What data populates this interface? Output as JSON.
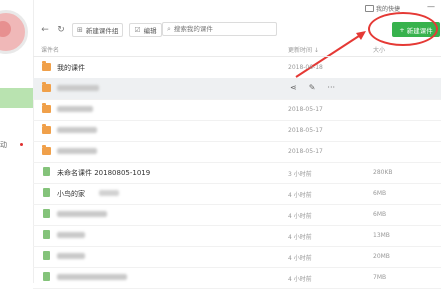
{
  "topbar": {
    "feedback_label": "我的快捷",
    "minimize_glyph": "—",
    "new_courseware_label": "新建课件"
  },
  "sidebar": {
    "item_text": "动"
  },
  "toolbar": {
    "back_glyph": "←",
    "refresh_glyph": "↻",
    "new_folder_label": "新建课件组",
    "edit_label": "编辑",
    "search_placeholder": "搜索我的课件"
  },
  "table": {
    "headers": {
      "name": "课件名",
      "date": "更新时间 ↓",
      "size": "大小"
    },
    "rows": [
      {
        "type": "folder",
        "name": "我的课件",
        "date": "2018-06-18",
        "size": ""
      },
      {
        "type": "folder",
        "name": "",
        "date": "",
        "size": "",
        "hover": true
      },
      {
        "type": "folder",
        "name": "",
        "date": "2018-05-17",
        "size": ""
      },
      {
        "type": "folder",
        "name": "",
        "date": "2018-05-17",
        "size": ""
      },
      {
        "type": "folder",
        "name": "",
        "date": "2018-05-17",
        "size": ""
      },
      {
        "type": "doc",
        "name": "未命名课件 20180805-1019",
        "date": "3 小时前",
        "size": "280KB"
      },
      {
        "type": "doc",
        "name": "小鸟的家",
        "date": "4 小时前",
        "size": "6MB"
      },
      {
        "type": "doc",
        "name": "",
        "date": "4 小时前",
        "size": "6MB"
      },
      {
        "type": "doc",
        "name": "",
        "date": "4 小时前",
        "size": "13MB"
      },
      {
        "type": "doc",
        "name": "",
        "date": "4 小时前",
        "size": "20MB"
      },
      {
        "type": "doc",
        "name": "",
        "date": "4 小时前",
        "size": "7MB"
      }
    ],
    "hover_actions": [
      "share-icon",
      "edit-icon",
      "more-icon"
    ]
  },
  "colors": {
    "accent_green": "#37b24d",
    "annotation_red": "#e53935",
    "folder_orange": "#f0a04a",
    "doc_green": "#84c37a"
  }
}
